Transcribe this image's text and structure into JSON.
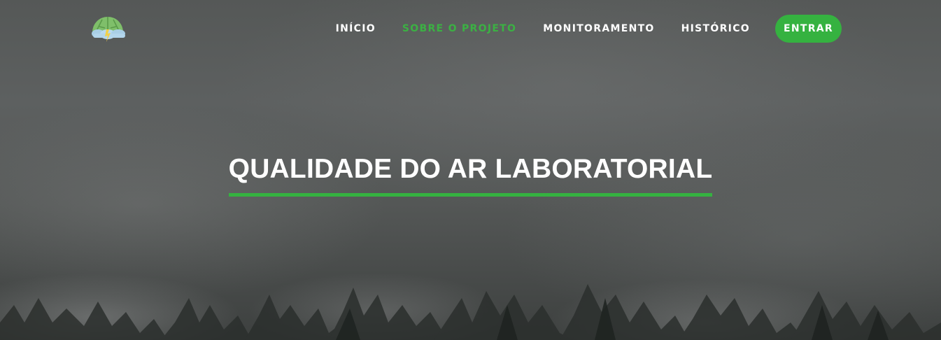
{
  "nav": {
    "links": [
      {
        "label": "INÍCIO",
        "active": false
      },
      {
        "label": "SOBRE O PROJETO",
        "active": true
      },
      {
        "label": "MONITORAMENTO",
        "active": false
      },
      {
        "label": "HISTÓRICO",
        "active": false
      }
    ],
    "cta_label": "ENTRAR"
  },
  "hero": {
    "title": "QUALIDADE DO AR LABORATORIAL"
  },
  "colors": {
    "accent": "#35b240",
    "active_link": "#3bb143",
    "text": "#ffffff"
  },
  "icons": {
    "logo": "tree-cloud-logo-icon"
  }
}
